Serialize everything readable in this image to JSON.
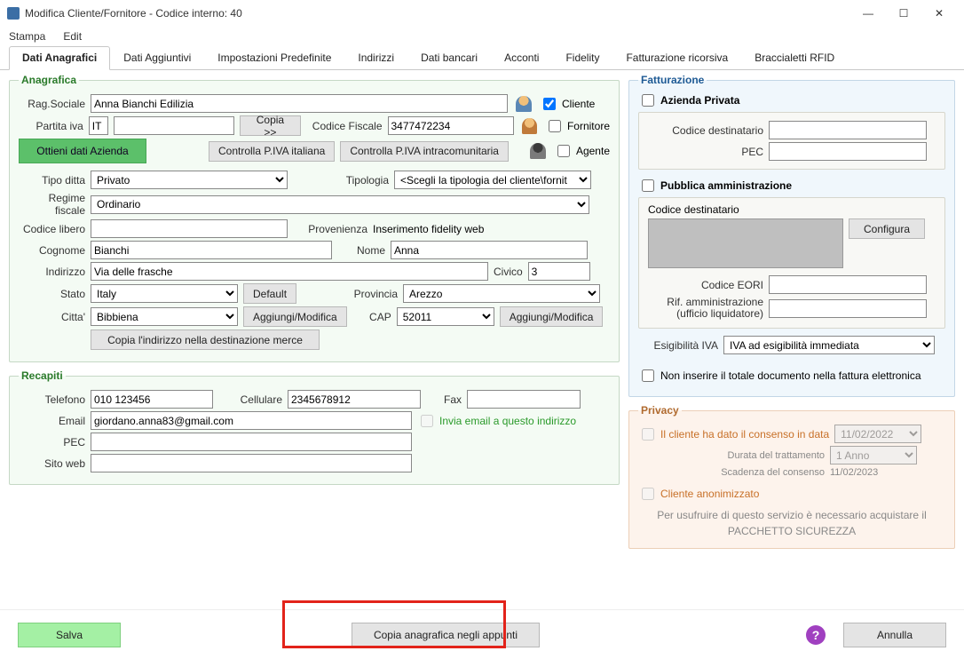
{
  "window": {
    "title": "Modifica Cliente/Fornitore - Codice interno: 40",
    "minimize": "—",
    "maximize": "☐",
    "close": "✕"
  },
  "menu": {
    "stampa": "Stampa",
    "edit": "Edit"
  },
  "tabs": {
    "dati_anagrafici": "Dati Anagrafici",
    "dati_aggiuntivi": "Dati Aggiuntivi",
    "impostazioni": "Impostazioni Predefinite",
    "indirizzi": "Indirizzi",
    "dati_bancari": "Dati bancari",
    "acconti": "Acconti",
    "fidelity": "Fidelity",
    "fatturazione_ric": "Fatturazione ricorsiva",
    "braccialetti": "Braccialetti RFID"
  },
  "anagrafica": {
    "legend": "Anagrafica",
    "rag_sociale_lbl": "Rag.Sociale",
    "rag_sociale": "Anna Bianchi Edilizia",
    "cliente_lbl": "Cliente",
    "partita_iva_lbl": "Partita iva",
    "piva_prefix": "IT",
    "piva_value": "",
    "copia_btn": "Copia >>",
    "codice_fiscale_lbl": "Codice Fiscale",
    "codice_fiscale": "3477472234",
    "fornitore_lbl": "Fornitore",
    "ottieni_btn": "Ottieni dati Azienda",
    "controlla_it": "Controlla P.IVA italiana",
    "controlla_intra": "Controlla P.IVA intracomunitaria",
    "agente_lbl": "Agente",
    "tipo_ditta_lbl": "Tipo ditta",
    "tipo_ditta": "Privato",
    "tipologia_lbl": "Tipologia",
    "tipologia": "<Scegli la tipologia del cliente\\fornit",
    "regime_lbl": "Regime fiscale",
    "regime": "Ordinario",
    "codice_libero_lbl": "Codice libero",
    "provenienza_lbl": "Provenienza",
    "provenienza": "Inserimento fidelity web",
    "cognome_lbl": "Cognome",
    "cognome": "Bianchi",
    "nome_lbl": "Nome",
    "nome": "Anna",
    "indirizzo_lbl": "Indirizzo",
    "indirizzo": "Via delle frasche",
    "civico_lbl": "Civico",
    "civico": "3",
    "stato_lbl": "Stato",
    "stato": "Italy",
    "default_btn": "Default",
    "provincia_lbl": "Provincia",
    "provincia": "Arezzo",
    "citta_lbl": "Citta'",
    "citta": "Bibbiena",
    "aggiungi_mod": "Aggiungi/Modifica",
    "cap_lbl": "CAP",
    "cap": "52011",
    "copia_indirizzo": "Copia l'indirizzo nella destinazione merce"
  },
  "recapiti": {
    "legend": "Recapiti",
    "telefono_lbl": "Telefono",
    "telefono": "010 123456",
    "cellulare_lbl": "Cellulare",
    "cellulare": "2345678912",
    "fax_lbl": "Fax",
    "fax": "",
    "email_lbl": "Email",
    "email": "giordano.anna83@gmail.com",
    "invia_email_lbl": "Invia email a questo indirizzo",
    "pec_lbl": "PEC",
    "sito_lbl": "Sito web"
  },
  "fatturazione": {
    "legend": "Fatturazione",
    "azienda_privata_lbl": "Azienda Privata",
    "codice_dest_lbl": "Codice destinatario",
    "pec_lbl": "PEC",
    "pubblica_amm_lbl": "Pubblica amministrazione",
    "codice_dest2_lbl": "Codice destinatario",
    "configura_btn": "Configura",
    "codice_eori_lbl": "Codice EORI",
    "rif_amm_lbl1": "Rif. amministrazione",
    "rif_amm_lbl2": "(ufficio liquidatore)",
    "esigibilita_lbl": "Esigibilità IVA",
    "esigibilita": "IVA ad esigibilità immediata",
    "non_inserire_lbl": "Non inserire il totale documento nella fattura elettronica"
  },
  "privacy": {
    "legend": "Privacy",
    "consenso_lbl": "Il cliente ha dato il consenso in data",
    "consenso_data": "11/02/2022",
    "durata_lbl": "Durata del trattamento",
    "durata": "1 Anno",
    "scadenza_lbl": "Scadenza del consenso",
    "scadenza": "11/02/2023",
    "anon_lbl": "Cliente anonimizzato",
    "info1": "Per usufruire di questo servizio è necessario acquistare il",
    "info2": "PACCHETTO SICUREZZA"
  },
  "footer": {
    "salva": "Salva",
    "copia_anag": "Copia anagrafica negli appunti",
    "annulla": "Annulla"
  }
}
